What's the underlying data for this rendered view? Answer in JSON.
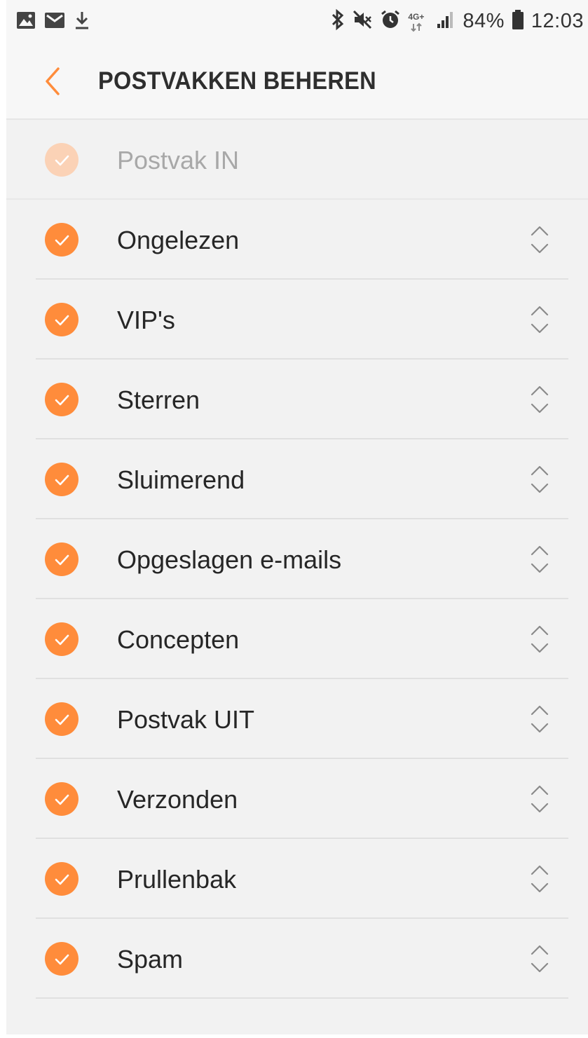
{
  "status_bar": {
    "battery": "84%",
    "time": "12:03",
    "network": "4G+"
  },
  "header": {
    "title": "POSTVAKKEN BEHEREN"
  },
  "colors": {
    "accent": "#ff8c3b",
    "accent_disabled": "#fbd2b6",
    "background": "#f2f2f2"
  },
  "folders": [
    {
      "label": "Postvak IN",
      "checked": true,
      "enabled": false
    },
    {
      "label": "Ongelezen",
      "checked": true,
      "enabled": true
    },
    {
      "label": "VIP's",
      "checked": true,
      "enabled": true
    },
    {
      "label": "Sterren",
      "checked": true,
      "enabled": true
    },
    {
      "label": "Sluimerend",
      "checked": true,
      "enabled": true
    },
    {
      "label": "Opgeslagen e-mails",
      "checked": true,
      "enabled": true
    },
    {
      "label": "Concepten",
      "checked": true,
      "enabled": true
    },
    {
      "label": "Postvak UIT",
      "checked": true,
      "enabled": true
    },
    {
      "label": "Verzonden",
      "checked": true,
      "enabled": true
    },
    {
      "label": "Prullenbak",
      "checked": true,
      "enabled": true
    },
    {
      "label": "Spam",
      "checked": true,
      "enabled": true
    }
  ]
}
